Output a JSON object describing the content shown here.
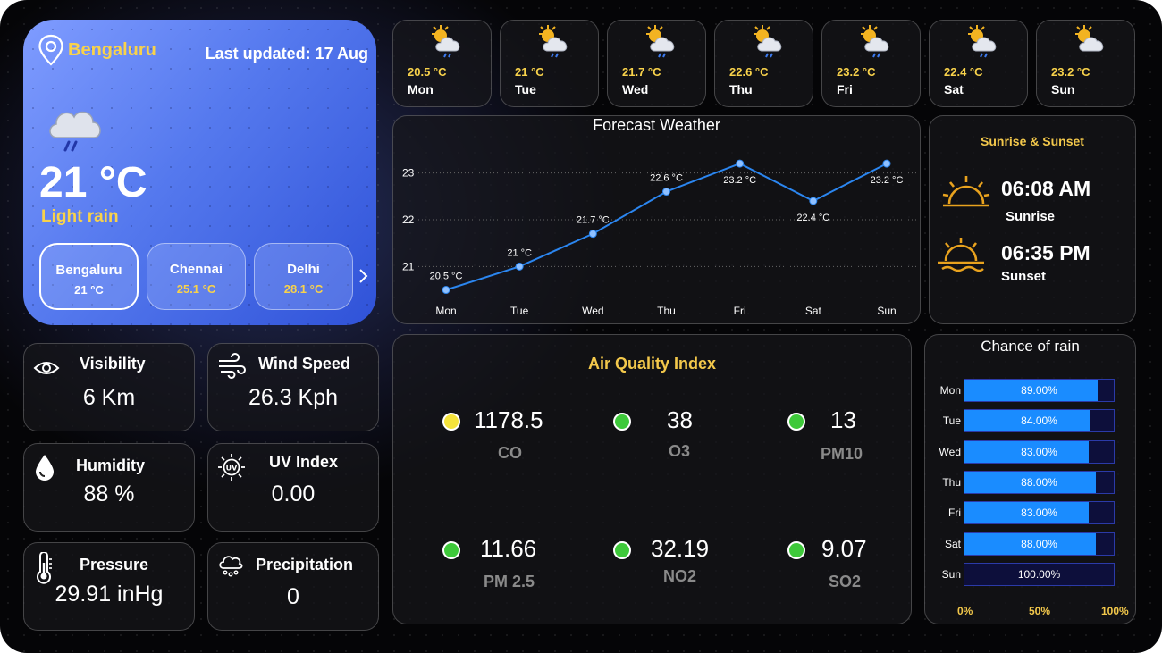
{
  "hero": {
    "city": "Bengaluru",
    "last_updated": "Last updated: 17 Aug",
    "temperature": "21 °C",
    "condition": "Light rain",
    "cities": [
      {
        "name": "Bengaluru",
        "temp": "21 °C"
      },
      {
        "name": "Chennai",
        "temp": "25.1 °C"
      },
      {
        "name": "Delhi",
        "temp": "28.1 °C"
      }
    ]
  },
  "daily": [
    {
      "day": "Mon",
      "temp": "20.5 °C",
      "icon": "partly-cloudy-rain-icon"
    },
    {
      "day": "Tue",
      "temp": "21 °C",
      "icon": "partly-cloudy-rain-icon"
    },
    {
      "day": "Wed",
      "temp": "21.7 °C",
      "icon": "partly-cloudy-rain-icon"
    },
    {
      "day": "Thu",
      "temp": "22.6 °C",
      "icon": "partly-cloudy-rain-icon"
    },
    {
      "day": "Fri",
      "temp": "23.2 °C",
      "icon": "partly-cloudy-rain-icon"
    },
    {
      "day": "Sat",
      "temp": "22.4 °C",
      "icon": "partly-cloudy-rain-icon"
    },
    {
      "day": "Sun",
      "temp": "23.2 °C",
      "icon": "partly-cloudy-icon"
    }
  ],
  "forecast": {
    "title": "Forecast Weather"
  },
  "sun": {
    "title": "Sunrise & Sunset",
    "sunrise_time": "06:08 AM",
    "sunrise_label": "Sunrise",
    "sunset_time": "06:35 PM",
    "sunset_label": "Sunset"
  },
  "stats": {
    "visibility": {
      "label": "Visibility",
      "value": "6 Km"
    },
    "wind": {
      "label": "Wind Speed",
      "value": "26.3 Kph"
    },
    "humidity": {
      "label": "Humidity",
      "value": "88 %"
    },
    "uv": {
      "label": "UV Index",
      "value": "0.00"
    },
    "pressure": {
      "label": "Pressure",
      "value": "29.91 inHg"
    },
    "precip": {
      "label": "Precipitation",
      "value": "0"
    }
  },
  "aqi": {
    "title": "Air Quality Index",
    "items": [
      {
        "value": "1178.5",
        "name": "CO",
        "color": "#f5e33b"
      },
      {
        "value": "38",
        "name": "O3",
        "color": "#3ec93a"
      },
      {
        "value": "13",
        "name": "PM10",
        "color": "#3ec93a"
      },
      {
        "value": "11.66",
        "name": "PM 2.5",
        "color": "#3ec93a"
      },
      {
        "value": "32.19",
        "name": "NO2",
        "color": "#3ec93a"
      },
      {
        "value": "9.07",
        "name": "SO2",
        "color": "#3ec93a"
      }
    ]
  },
  "rain": {
    "title": "Chance of rain",
    "axis": [
      "0%",
      "50%",
      "100%"
    ]
  },
  "colors": {
    "accent_yellow": "#f8d24b",
    "line_blue": "#2b86f0",
    "bar_blue": "#1a8cff",
    "good_green": "#3ec93a"
  },
  "chart_data": [
    {
      "type": "line",
      "title": "Forecast Weather",
      "categories": [
        "Mon",
        "Tue",
        "Wed",
        "Thu",
        "Fri",
        "Sat",
        "Sun"
      ],
      "values": [
        20.5,
        21,
        21.7,
        22.6,
        23.2,
        22.4,
        23.2
      ],
      "data_labels": [
        "20.5 °C",
        "21 °C",
        "21.7 °C",
        "22.6 °C",
        "23.2 °C",
        "22.4 °C",
        "23.2 °C"
      ],
      "yticks": [
        21,
        22,
        23
      ],
      "ylim": [
        20.3,
        23.45
      ],
      "grid": true
    },
    {
      "type": "bar",
      "orientation": "horizontal",
      "title": "Chance of rain",
      "categories": [
        "Mon",
        "Tue",
        "Wed",
        "Thu",
        "Fri",
        "Sat",
        "Sun"
      ],
      "values": [
        89,
        84,
        83,
        88,
        83,
        88,
        100
      ],
      "data_labels": [
        "89.00%",
        "84.00%",
        "83.00%",
        "88.00%",
        "83.00%",
        "88.00%",
        "100.00%"
      ],
      "xlim": [
        0,
        100
      ]
    }
  ]
}
